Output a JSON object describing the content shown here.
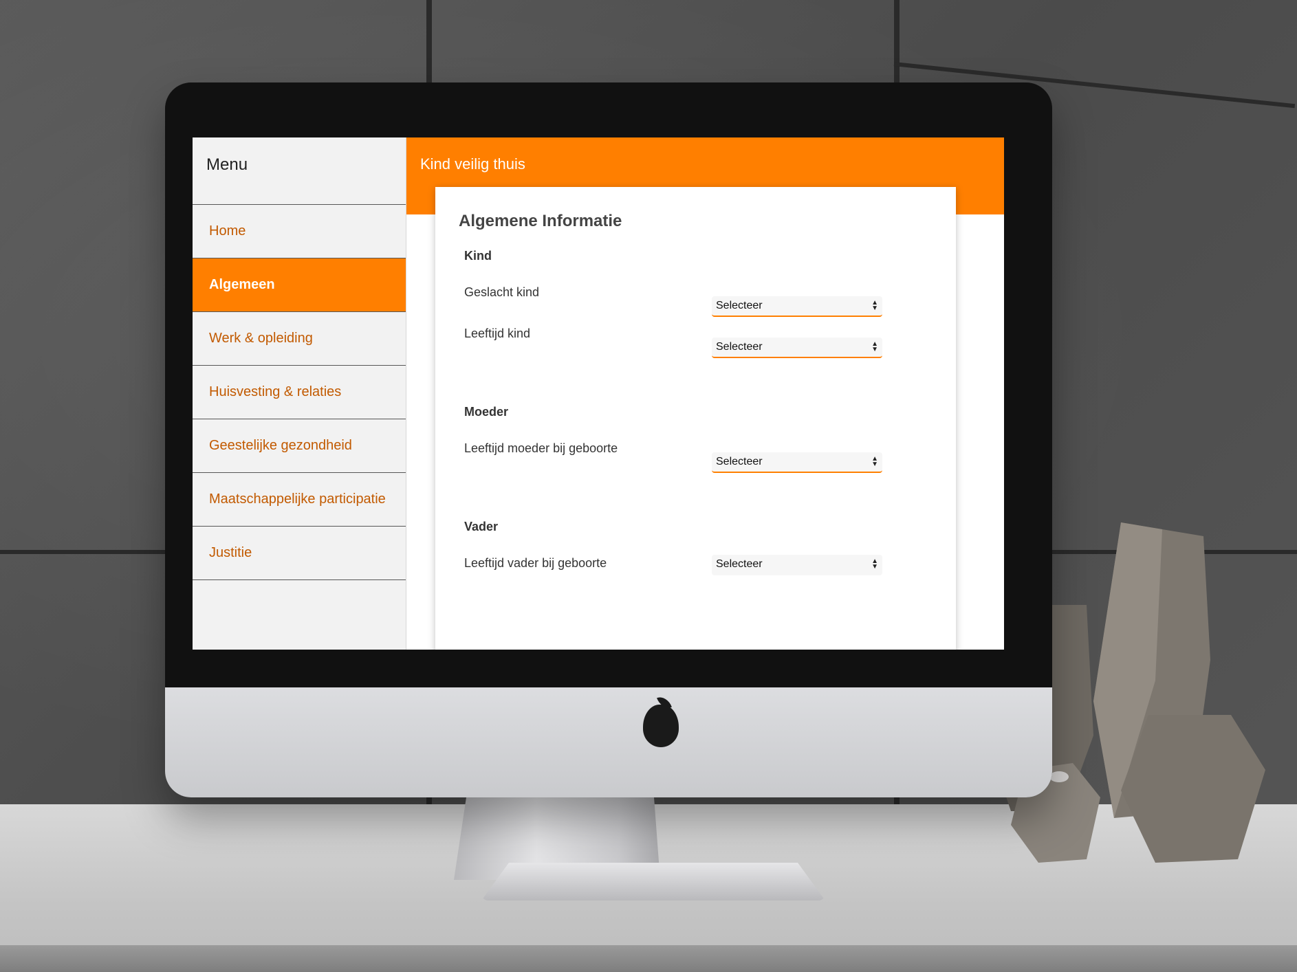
{
  "app": {
    "header_title": "Kind veilig thuis"
  },
  "sidebar": {
    "menu_title": "Menu",
    "items": [
      {
        "label": "Home",
        "active": false
      },
      {
        "label": "Algemeen",
        "active": true
      },
      {
        "label": "Werk & opleiding",
        "active": false
      },
      {
        "label": "Huisvesting & relaties",
        "active": false
      },
      {
        "label": "Geestelijke gezondheid",
        "active": false
      },
      {
        "label": "Maatschappelijke participatie",
        "active": false
      },
      {
        "label": "Justitie",
        "active": false
      }
    ]
  },
  "form": {
    "title": "Algemene Informatie",
    "sections": [
      {
        "title": "Kind",
        "fields": [
          {
            "label": "Geslacht kind",
            "value": "Selecteer"
          },
          {
            "label": "Leeftijd kind",
            "value": "Selecteer"
          }
        ]
      },
      {
        "title": "Moeder",
        "fields": [
          {
            "label": "Leeftijd moeder bij geboorte",
            "value": "Selecteer"
          }
        ]
      },
      {
        "title": "Vader",
        "fields": [
          {
            "label": "Leeftijd vader bij geboorte",
            "value": "Selecteer"
          }
        ]
      }
    ]
  },
  "colors": {
    "accent": "#ff7f00",
    "nav_text": "#c25a00",
    "sidebar_bg": "#f2f2f2"
  }
}
